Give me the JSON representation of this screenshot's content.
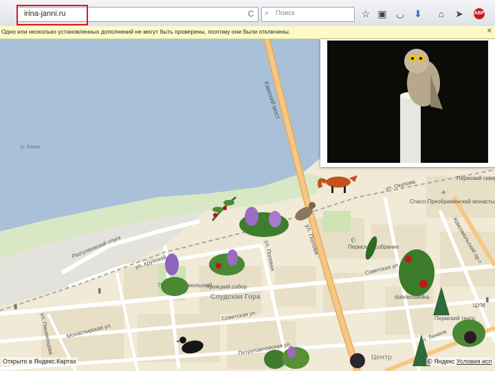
{
  "browser": {
    "url": "irina-janni.ru",
    "search_placeholder": "Поиск",
    "reload_glyph": "C",
    "icons": [
      "star-icon",
      "clipboard-icon",
      "pocket-icon",
      "download-icon",
      "home-icon",
      "send-icon"
    ],
    "abp_label": "ABP"
  },
  "notification": {
    "text": "Одно или несколько установленных дополнений не могут быть проверены, поэтому они были отключены."
  },
  "map": {
    "labels": {
      "river": "р. Кама",
      "bridge": "Камский мост",
      "street_okulova": "ул. Окулова",
      "street_popova": "ул. Попова",
      "descent": "Разгуляевский спуск",
      "krupskoy": "ул. Крупской",
      "sovetskaya": "Советская ул.",
      "sovetskaya2": "Советская ул.",
      "monastyrskaya": "Монастырская ул.",
      "pishmentsova": "ул. Пишменцова",
      "polevaya": "ул. Полевая",
      "petropavlovskaya": "Петропавловская ул.",
      "lenina": "ул. Ленина",
      "kommunisticheskaya": "Комсомольский пр-т",
      "slud_gora": "Слудская Гора",
      "park": "Парк Комсомольский",
      "sobor": "Троицкий собор",
      "sobranie": "Пермское собрание",
      "monastery": "Спасо-Преображенский монастырь",
      "station": "Пермский сквер",
      "tsum": "ЦУМ",
      "centre": "Центр",
      "opera": "Пермский театр",
      "school": "dobrasosedka"
    }
  },
  "footer": {
    "left": "Открыто в Яндекс.Картах",
    "right_brand": "© Яндекс",
    "right_link": "Условия исп"
  },
  "colors": {
    "river": "#a9c1d8",
    "road_main": "#f6c784",
    "highlight": "#d9141b",
    "notif_bg": "#fdfac8"
  }
}
